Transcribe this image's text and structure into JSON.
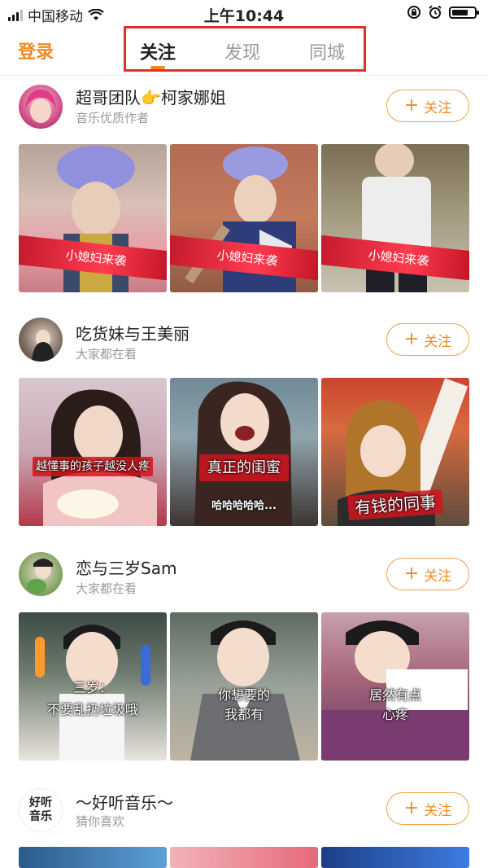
{
  "status": {
    "carrier": "中国移动",
    "time": "上午10:44"
  },
  "nav": {
    "login": "登录",
    "tabs": [
      {
        "label": "关注"
      },
      {
        "label": "发现"
      },
      {
        "label": "同城"
      }
    ],
    "active_tab": 0
  },
  "follow_label": "关注",
  "feed": [
    {
      "name": "超哥团队👉柯家娜姐",
      "subtitle": "音乐优质作者",
      "thumbs": [
        {
          "caption": "小媳妇来袭"
        },
        {
          "caption": "小媳妇来袭"
        },
        {
          "caption": "小媳妇来袭"
        }
      ]
    },
    {
      "name": "吃货妹与王美丽",
      "subtitle": "大家都在看",
      "thumbs": [
        {
          "caption": "越懂事的孩子越没人疼"
        },
        {
          "caption": "真正的闺蜜",
          "caption2": "哈哈哈哈哈..."
        },
        {
          "caption": "有钱的同事"
        }
      ]
    },
    {
      "name": "恋与三岁Sam",
      "subtitle": "大家都在看",
      "thumbs": [
        {
          "caption": "三岁：",
          "caption2": "不要乱扔垃圾哦"
        },
        {
          "caption": "你想要的",
          "caption2": "我都有"
        },
        {
          "caption": "居然有点",
          "caption2": "心疼"
        }
      ]
    },
    {
      "name": "～好听音乐～",
      "subtitle": "猜你喜欢",
      "avatar_text_1": "好听",
      "avatar_text_2": "音乐"
    }
  ],
  "colors": {
    "accent": "#f08a24",
    "highlight_box": "#e0302a"
  }
}
